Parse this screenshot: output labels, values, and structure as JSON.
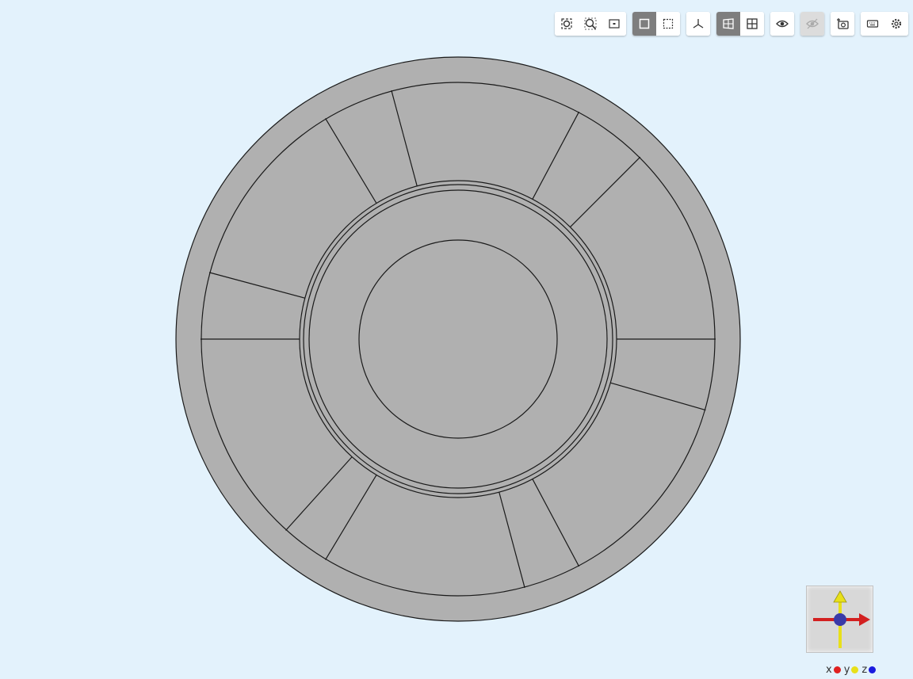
{
  "toolbar": {
    "groups": [
      [
        {
          "name": "zoom-extents-icon",
          "active": false,
          "disabled": false
        },
        {
          "name": "zoom-box-icon",
          "active": false,
          "disabled": false
        },
        {
          "name": "zoom-selection-icon",
          "active": false,
          "disabled": false
        }
      ],
      [
        {
          "name": "select-box-icon",
          "active": true,
          "disabled": false
        },
        {
          "name": "select-dashed-box-icon",
          "active": false,
          "disabled": false
        }
      ],
      [
        {
          "name": "axis-orientation-icon",
          "active": false,
          "disabled": false
        }
      ],
      [
        {
          "name": "perspective-view-icon",
          "active": true,
          "disabled": false
        },
        {
          "name": "orthographic-grid-icon",
          "active": false,
          "disabled": false
        }
      ],
      [
        {
          "name": "view-visibility-icon",
          "active": false,
          "disabled": false
        }
      ],
      [
        {
          "name": "hide-visibility-icon",
          "active": false,
          "disabled": true
        }
      ],
      [
        {
          "name": "add-camera-icon",
          "active": false,
          "disabled": false
        }
      ],
      [
        {
          "name": "keyboard-icon",
          "active": false,
          "disabled": false
        },
        {
          "name": "settings-gear-icon",
          "active": false,
          "disabled": false
        }
      ]
    ]
  },
  "colors": {
    "background": "#e3f2fc",
    "model_fill": "#b0b0b0",
    "edge": "#1a1a1a",
    "x_axis": "#d32020",
    "y_axis": "#e8e01a",
    "z_axis": "#1a1adf"
  },
  "axis_legend": {
    "x": "x",
    "y": "y",
    "z": "z"
  }
}
